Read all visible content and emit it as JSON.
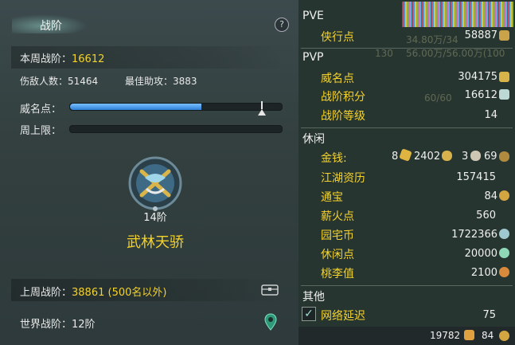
{
  "left": {
    "title": "战阶",
    "help": "?",
    "weekly_rank_label": "本周战阶：",
    "weekly_rank_value": "16612",
    "kills_label": "伤敌人数：",
    "kills_value": "51464",
    "assist_label": "最佳助攻：",
    "assist_value": "3883",
    "prestige_label": "威名点：",
    "prestige_progress": 0.62,
    "week_limit_label": "周上限：",
    "tier_small": "14阶",
    "tier_name": "武林天骄",
    "last_week_label": "上周战阶：",
    "last_week_value": "38861 (500名以外)",
    "world_rank_label": "世界战阶：",
    "world_rank_value": "12阶"
  },
  "right": {
    "pve_header": "PVE",
    "pve_items": [
      {
        "label": "侠行点",
        "value": "58887"
      }
    ],
    "pvp_header": "PVP",
    "pvp_items": [
      {
        "label": "威名点",
        "value": "304175"
      },
      {
        "label": "战阶积分",
        "value": "16612"
      },
      {
        "label": "战阶等级",
        "value": "14"
      }
    ],
    "leisure_header": "休闲",
    "money_label": "金钱:",
    "money_gold": "8",
    "money_silver": "2402",
    "money_copper_a": "3",
    "money_copper_b": "69",
    "leisure_items": [
      {
        "label": "江湖资历",
        "value": "157415"
      },
      {
        "label": "通宝",
        "value": "84"
      },
      {
        "label": "薪火点",
        "value": "560"
      },
      {
        "label": "园宅币",
        "value": "1722366"
      },
      {
        "label": "休闲点",
        "value": "20000"
      },
      {
        "label": "桃李值",
        "value": "2100"
      }
    ],
    "other_header": "其他",
    "latency_label": "网络延迟",
    "latency_value": "75",
    "bottom_left_value": "19782",
    "bottom_right_value": "84",
    "bg_texts": [
      "34.80万/34",
      "130",
      "56.00万/56.00万(100",
      "60/60"
    ]
  },
  "colors": {
    "accent_yellow": "#f4d22b",
    "bar_blue": "#3a8ae0",
    "panel_bg": "#33403f"
  }
}
